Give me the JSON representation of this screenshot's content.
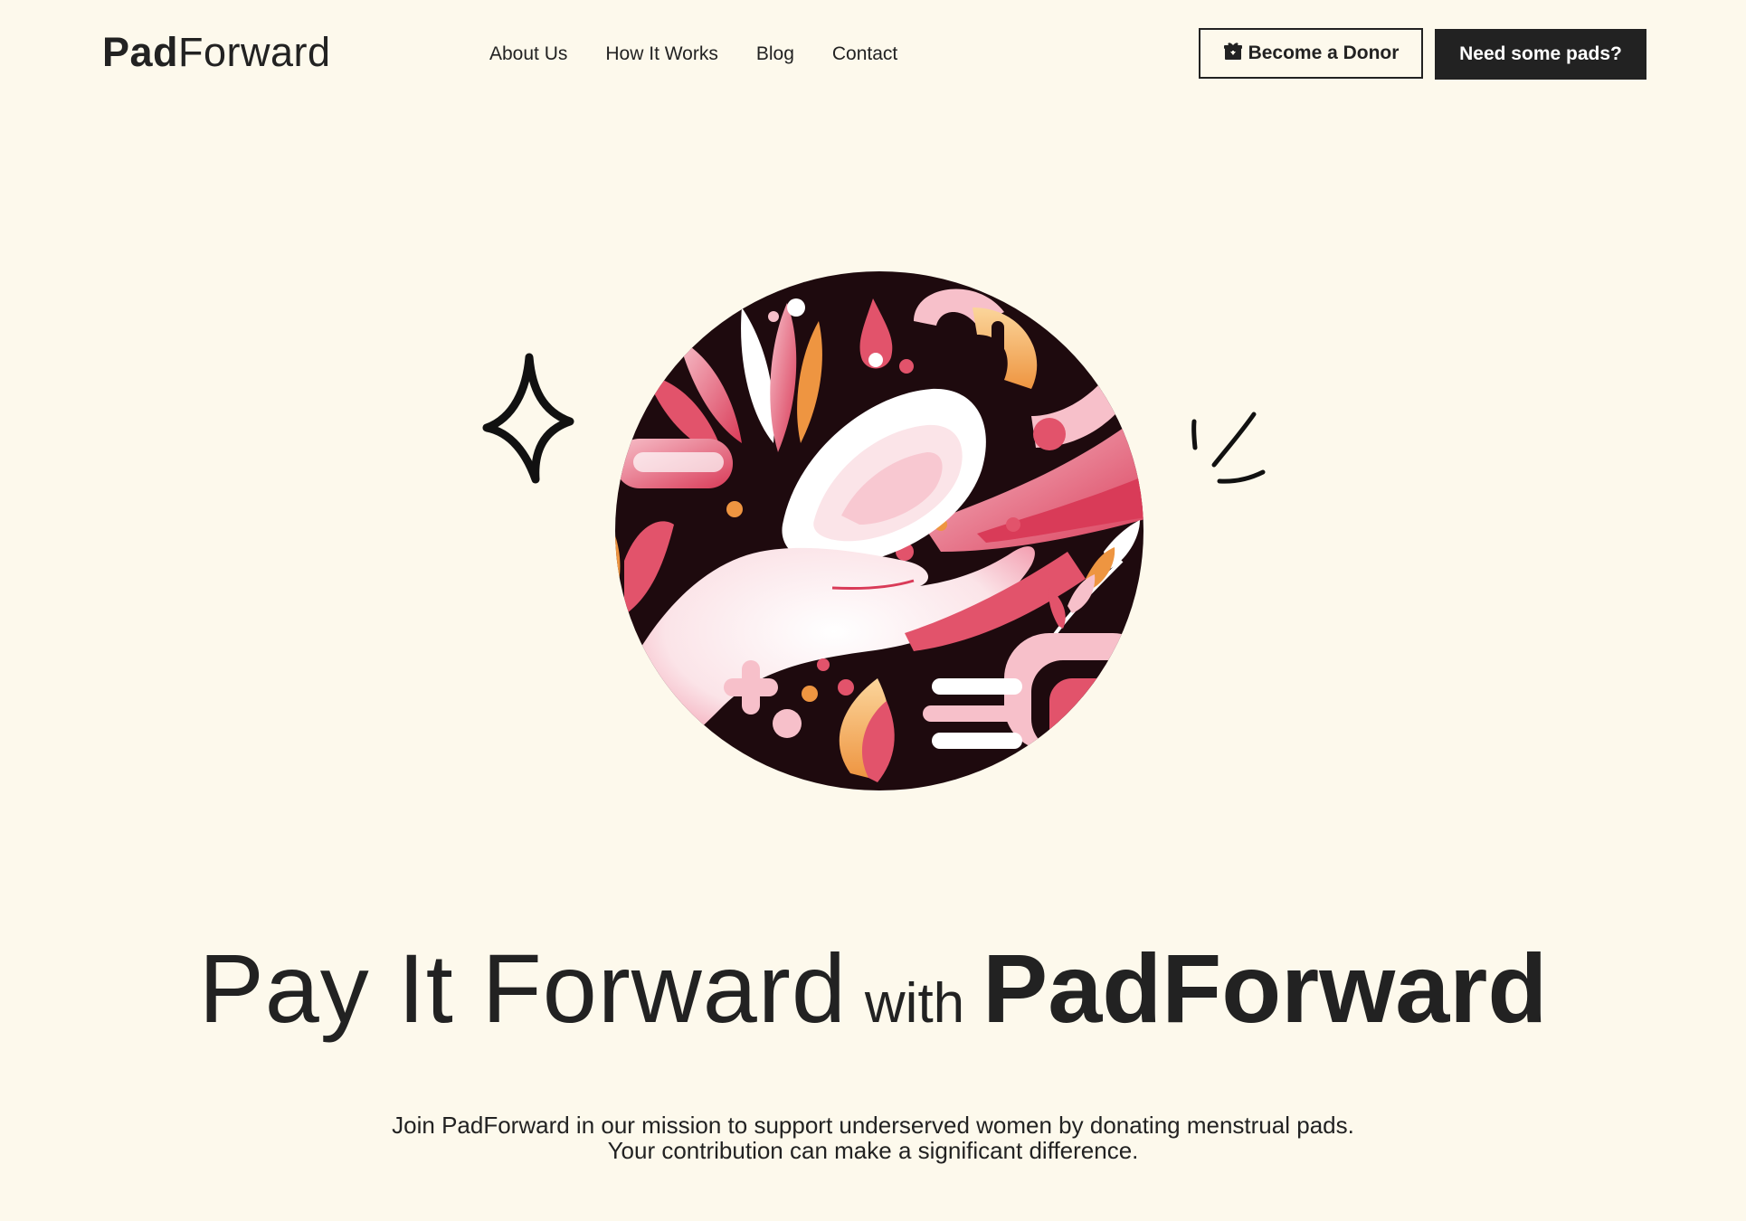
{
  "header": {
    "logo_bold": "Pad",
    "logo_light": "Forward",
    "nav": [
      {
        "label": "About Us"
      },
      {
        "label": "How It Works"
      },
      {
        "label": "Blog"
      },
      {
        "label": "Contact"
      }
    ],
    "donor_button": {
      "label": "Become a Donor",
      "icon": "gift-icon"
    },
    "pads_button": {
      "label": "Need some pads?"
    }
  },
  "hero": {
    "headline_part1": "Pay It Forward",
    "headline_connector": "with",
    "headline_brand": "PadForward",
    "subtext_line1": "Join PadForward in our mission to support underserved women by donating menstrual pads.",
    "subtext_line2": "Your contribution can make a significant difference.",
    "illustration": "hand-holding-pad-illustration"
  },
  "colors": {
    "background": "#fdf9ec",
    "text": "#222222",
    "accent_pink": "#e2536b",
    "accent_orange": "#f2a65a",
    "dark_maroon": "#1e0a0e"
  }
}
